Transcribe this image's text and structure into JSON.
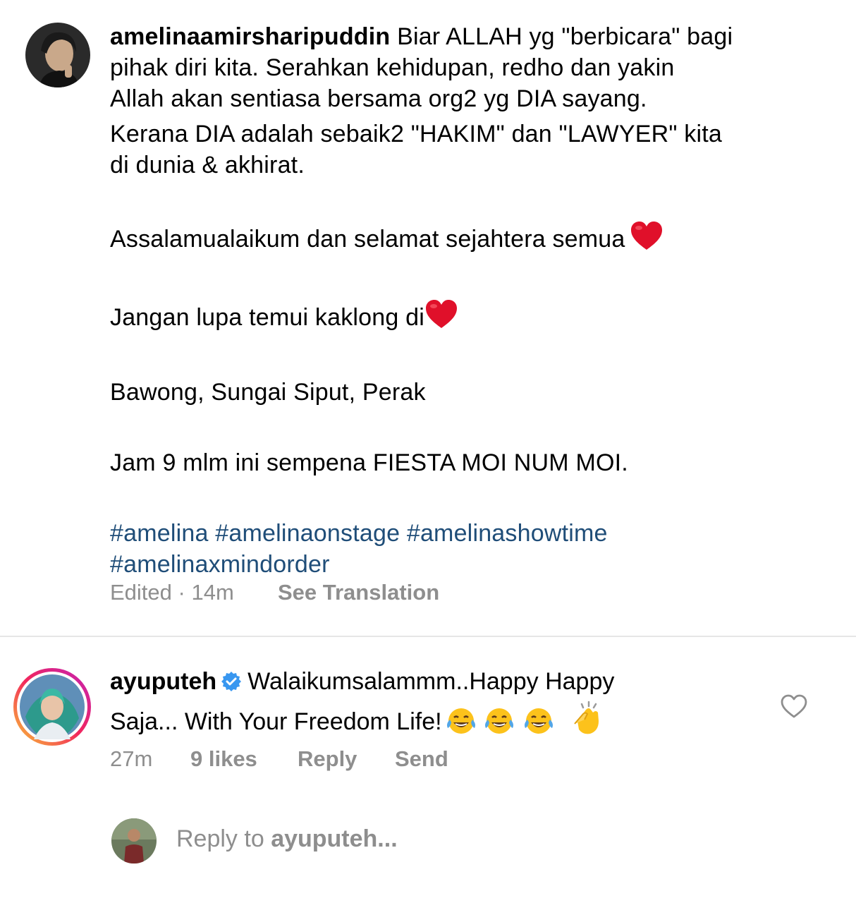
{
  "post": {
    "username": "amelinaamirsharipuddin",
    "caption_lines": [
      "Biar ALLAH yg \"berbicara\" bagi",
      "pihak diri kita. Serahkan kehidupan, redho dan yakin",
      "Allah akan sentiasa bersama org2 yg DIA sayang.",
      "Kerana DIA adalah sebaik2 \"HAKIM\" dan \"LAWYER\" kita",
      "di dunia & akhirat."
    ],
    "greeting": "Assalamualaikum dan selamat sejahtera semua",
    "invite": "Jangan lupa temui kaklong di",
    "location": "Bawong, Sungai Siput, Perak",
    "event": "Jam 9 mlm ini sempena FIESTA MOI NUM MOI.",
    "hashtags_line1": "#amelina #amelinaonstage #amelinashowtime",
    "hashtags_line2": "#amelinaxmindorder",
    "edited_label": "Edited",
    "separator": "·",
    "time": "14m",
    "see_translation": "See Translation"
  },
  "comment": {
    "username": "ayuputeh",
    "text_line1": "Walaikumsalammm..Happy Happy",
    "text_line2": "Saja... With Your Freedom Life!",
    "time": "27m",
    "likes": "9 likes",
    "reply_label": "Reply",
    "send_label": "Send"
  },
  "reply_box": {
    "prefix": "Reply to",
    "target": "ayuputeh..."
  },
  "icons": {
    "heart_emoji": "red-heart-icon",
    "verified": "verified-badge-icon",
    "laughing_emoji": "tears-of-joy-icon",
    "clapping_emoji": "clapping-hands-icon",
    "like": "heart-outline-icon"
  },
  "colors": {
    "hashtag": "#1f4d78",
    "secondary_text": "#8e8e8e",
    "verified_blue": "#3897f0",
    "heart_red": "#e0102a"
  }
}
